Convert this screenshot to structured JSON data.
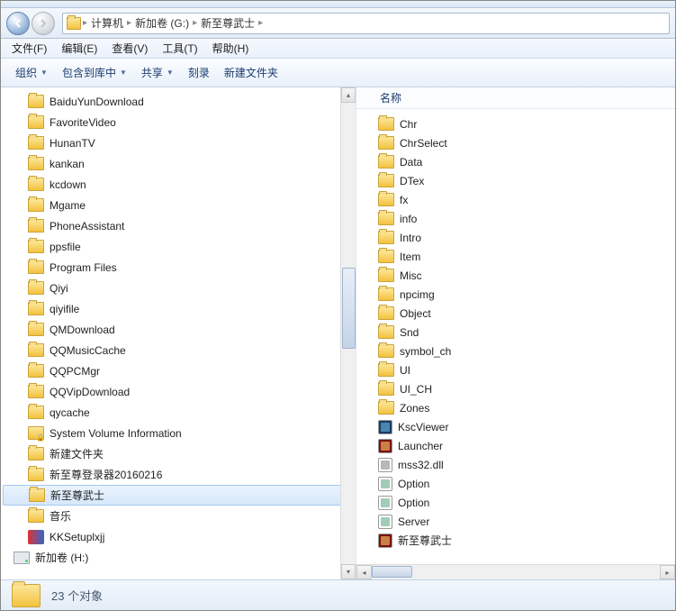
{
  "breadcrumb": {
    "seg1": "计算机",
    "seg2": "新加卷 (G:)",
    "seg3": "新至尊武士"
  },
  "menu": {
    "file": "文件(F)",
    "edit": "编辑(E)",
    "view": "查看(V)",
    "tools": "工具(T)",
    "help": "帮助(H)"
  },
  "toolbar": {
    "org": "组织",
    "lib": "包含到库中",
    "share": "共享",
    "burn": "刻录",
    "newf": "新建文件夹"
  },
  "column": {
    "name": "名称"
  },
  "tree": {
    "items": [
      {
        "label": "BaiduYunDownload",
        "icon": "folder"
      },
      {
        "label": "FavoriteVideo",
        "icon": "folder"
      },
      {
        "label": "HunanTV",
        "icon": "folder"
      },
      {
        "label": "kankan",
        "icon": "folder"
      },
      {
        "label": "kcdown",
        "icon": "folder"
      },
      {
        "label": "Mgame",
        "icon": "folder"
      },
      {
        "label": "PhoneAssistant",
        "icon": "folder"
      },
      {
        "label": "ppsfile",
        "icon": "folder"
      },
      {
        "label": "Program Files",
        "icon": "folder"
      },
      {
        "label": "Qiyi",
        "icon": "folder"
      },
      {
        "label": "qiyifile",
        "icon": "folder"
      },
      {
        "label": "QMDownload",
        "icon": "folder"
      },
      {
        "label": "QQMusicCache",
        "icon": "folder"
      },
      {
        "label": "QQPCMgr",
        "icon": "folder"
      },
      {
        "label": "QQVipDownload",
        "icon": "folder"
      },
      {
        "label": "qycache",
        "icon": "folder"
      },
      {
        "label": "System Volume Information",
        "icon": "lock"
      },
      {
        "label": "新建文件夹",
        "icon": "folder"
      },
      {
        "label": "新至尊登录器20160216",
        "icon": "folder"
      },
      {
        "label": "新至尊武士",
        "icon": "folder",
        "selected": true
      },
      {
        "label": "音乐",
        "icon": "folder"
      },
      {
        "label": "KKSetuplxjj",
        "icon": "app",
        "color1": "#d33",
        "color2": "#36c"
      },
      {
        "label": "新加卷 (H:)",
        "icon": "drive",
        "indent": true
      }
    ]
  },
  "files": {
    "items": [
      {
        "label": "Chr",
        "type": "folder"
      },
      {
        "label": "ChrSelect",
        "type": "folder"
      },
      {
        "label": "Data",
        "type": "folder"
      },
      {
        "label": "DTex",
        "type": "folder"
      },
      {
        "label": "fx",
        "type": "folder"
      },
      {
        "label": "info",
        "type": "folder"
      },
      {
        "label": "Intro",
        "type": "folder"
      },
      {
        "label": "Item",
        "type": "folder"
      },
      {
        "label": "Misc",
        "type": "folder"
      },
      {
        "label": "npcimg",
        "type": "folder"
      },
      {
        "label": "Object",
        "type": "folder"
      },
      {
        "label": "Snd",
        "type": "folder"
      },
      {
        "label": "symbol_ch",
        "type": "folder"
      },
      {
        "label": "UI",
        "type": "folder"
      },
      {
        "label": "UI_CH",
        "type": "folder"
      },
      {
        "label": "Zones",
        "type": "folder"
      },
      {
        "label": "KscViewer",
        "type": "app",
        "bg": "#1a3a6a",
        "fg": "#6bd"
      },
      {
        "label": "Launcher",
        "type": "app",
        "bg": "#7a1010",
        "fg": "#fc6"
      },
      {
        "label": "mss32.dll",
        "type": "dll",
        "bg": "#fff",
        "fg": "#888"
      },
      {
        "label": "Option",
        "type": "cfg",
        "bg": "#fff",
        "fg": "#6a8"
      },
      {
        "label": "Option",
        "type": "cfg",
        "bg": "#fff",
        "fg": "#6a8"
      },
      {
        "label": "Server",
        "type": "cfg",
        "bg": "#fff",
        "fg": "#6a8"
      },
      {
        "label": "新至尊武士",
        "type": "app",
        "bg": "#7a1010",
        "fg": "#fc6"
      }
    ]
  },
  "status": {
    "text": "23 个对象"
  }
}
